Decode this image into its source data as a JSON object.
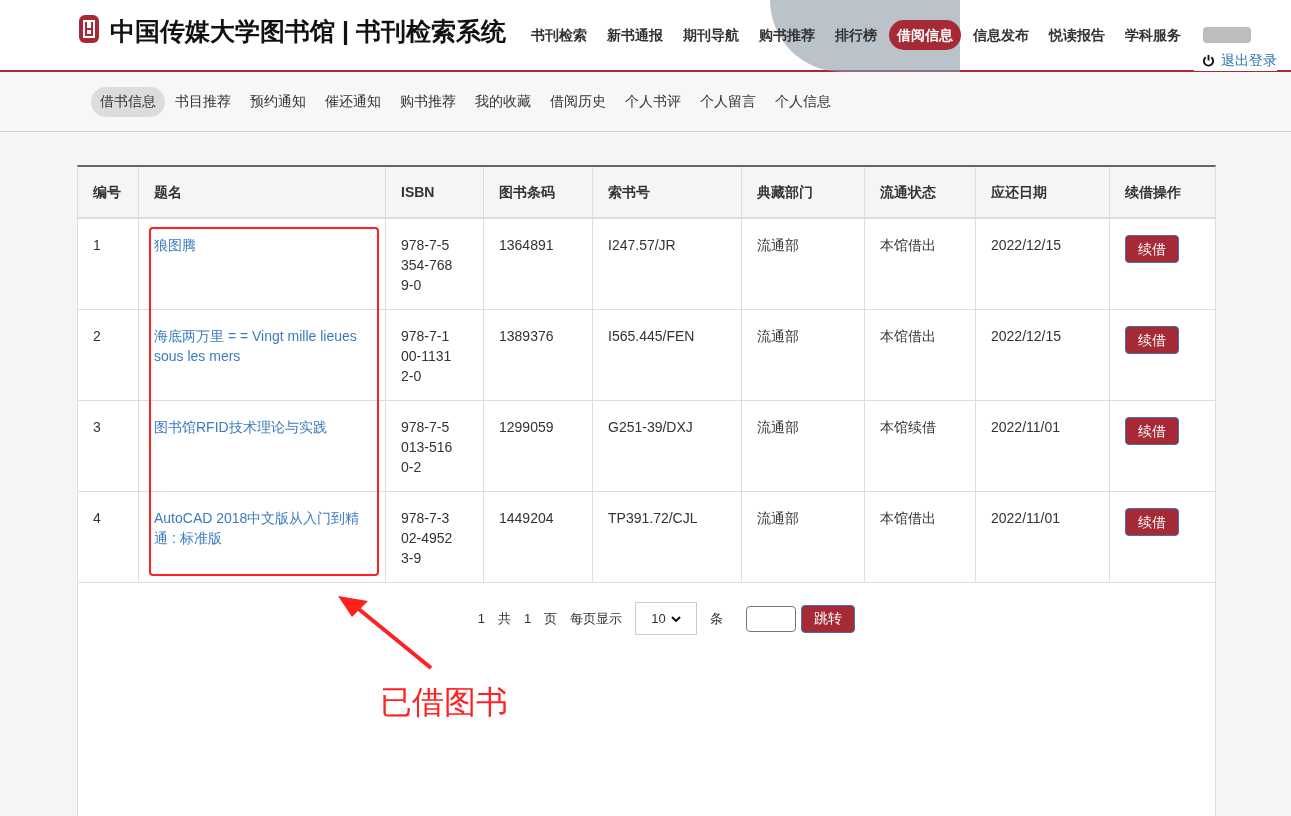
{
  "header": {
    "title": "中国传媒大学图书馆 | 书刊检索系统",
    "nav": [
      {
        "label": "书刊检索",
        "selected": false
      },
      {
        "label": "新书通报",
        "selected": false
      },
      {
        "label": "期刊导航",
        "selected": false
      },
      {
        "label": "购书推荐",
        "selected": false
      },
      {
        "label": "排行榜",
        "selected": false
      },
      {
        "label": "借阅信息",
        "selected": true
      },
      {
        "label": "信息发布",
        "selected": false
      },
      {
        "label": "悦读报告",
        "selected": false
      },
      {
        "label": "学科服务",
        "selected": false
      }
    ],
    "logout": "退出登录"
  },
  "subnav": [
    {
      "label": "借书信息",
      "selected": true
    },
    {
      "label": "书目推荐",
      "selected": false
    },
    {
      "label": "预约通知",
      "selected": false
    },
    {
      "label": "催还通知",
      "selected": false
    },
    {
      "label": "购书推荐",
      "selected": false
    },
    {
      "label": "我的收藏",
      "selected": false
    },
    {
      "label": "借阅历史",
      "selected": false
    },
    {
      "label": "个人书评",
      "selected": false
    },
    {
      "label": "个人留言",
      "selected": false
    },
    {
      "label": "个人信息",
      "selected": false
    }
  ],
  "table": {
    "columns": [
      "编号",
      "题名",
      "ISBN",
      "图书条码",
      "索书号",
      "典藏部门",
      "流通状态",
      "应还日期",
      "续借操作"
    ],
    "rows": [
      {
        "no": "1",
        "title": "狼图腾",
        "isbn": "978-7-5354-7689-0",
        "barcode": "1364891",
        "callno": "I247.57/JR",
        "dept": "流通部",
        "status": "本馆借出",
        "due": "2022/12/15",
        "action": "续借"
      },
      {
        "no": "2",
        "title": "海底两万里 = = Vingt mille lieues sous les mers",
        "isbn": "978-7-100-11312-0",
        "barcode": "1389376",
        "callno": "I565.445/FEN",
        "dept": "流通部",
        "status": "本馆借出",
        "due": "2022/12/15",
        "action": "续借"
      },
      {
        "no": "3",
        "title": "图书馆RFID技术理论与实践",
        "isbn": "978-7-5013-5160-2",
        "barcode": "1299059",
        "callno": "G251-39/DXJ",
        "dept": "流通部",
        "status": "本馆续借",
        "due": "2022/11/01",
        "action": "续借"
      },
      {
        "no": "4",
        "title": "AutoCAD 2018中文版从入门到精通 : 标准版",
        "isbn": "978-7-302-49523-9",
        "barcode": "1449204",
        "callno": "TP391.72/CJL",
        "dept": "流通部",
        "status": "本馆借出",
        "due": "2022/11/01",
        "action": "续借"
      }
    ]
  },
  "pagination": {
    "current": "1",
    "total_label": "共",
    "total": "1",
    "page_unit": "页",
    "per_page_label": "每页显示",
    "per_page": "10",
    "item_unit": "条",
    "jump_button": "跳转"
  },
  "annotation": {
    "label": "已借图书"
  }
}
